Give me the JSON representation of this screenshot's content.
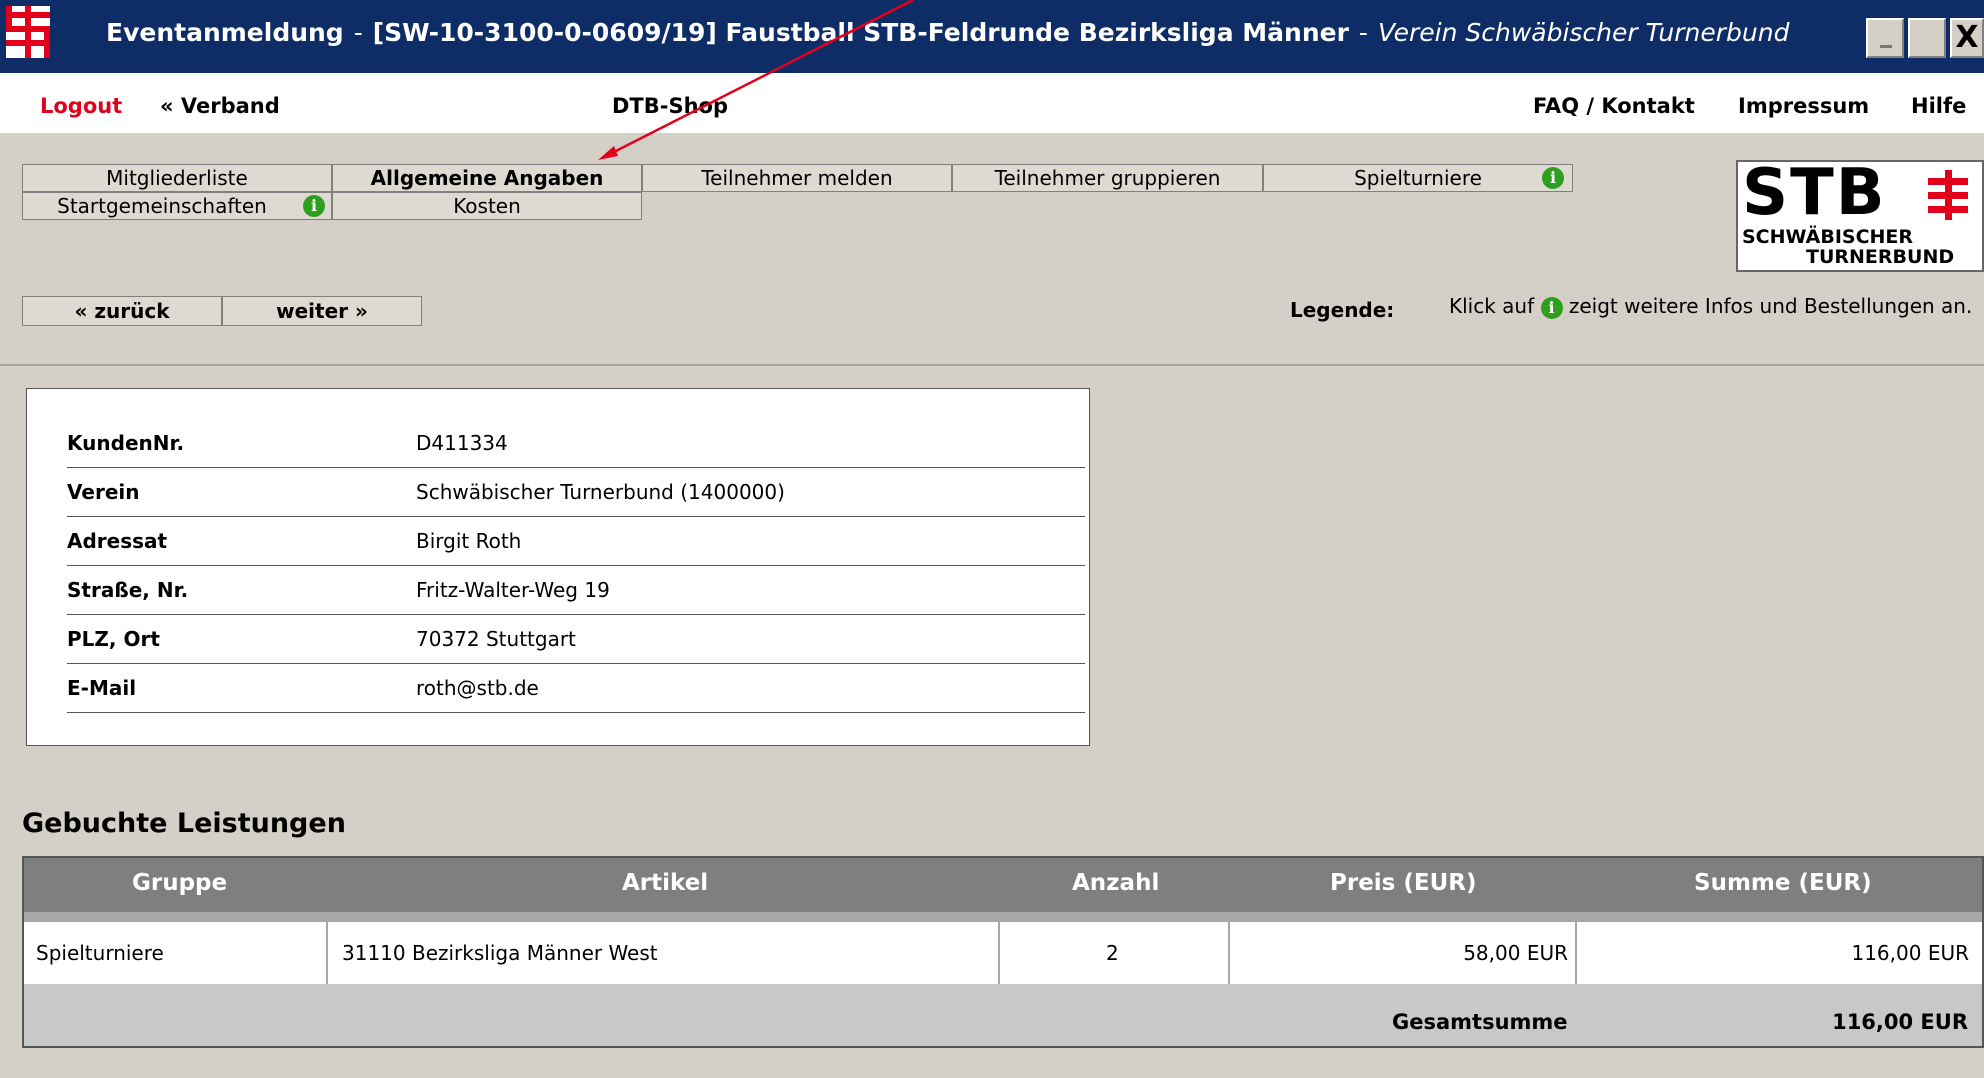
{
  "window": {
    "title_main": "Eventanmeldung",
    "title_sep": "-",
    "title_event": "[SW-10-3100-0-0609/19] Faustball STB-Feldrunde Bezirksliga Männer",
    "title_sep2": "-",
    "title_club": "Verein Schwäbischer Turnerbund",
    "close_label": "X"
  },
  "topnav": {
    "logout": "Logout",
    "verband": "« Verband",
    "shop": "DTB-Shop",
    "faq": "FAQ / Kontakt",
    "impressum": "Impressum",
    "hilfe": "Hilfe"
  },
  "tabs": {
    "mitgliederliste": "Mitgliederliste",
    "allgemeine": "Allgemeine Angaben",
    "teilnehmer_melden": "Teilnehmer melden",
    "teilnehmer_gruppieren": "Teilnehmer gruppieren",
    "spielturniere": "Spielturniere",
    "startgemeinschaften": "Startgemeinschaften",
    "kosten": "Kosten"
  },
  "logo": {
    "word": "STB",
    "line1": "SCHWÄBISCHER",
    "line2": "TURNERBUND"
  },
  "nav": {
    "back": "« zurück",
    "next": "weiter »"
  },
  "legend": {
    "label": "Legende:",
    "text_before": "Klick auf",
    "text_after": "zeigt weitere Infos und Bestellungen an.",
    "info_glyph": "i"
  },
  "customer": {
    "rows": [
      {
        "key": "KundenNr.",
        "value": "D411334"
      },
      {
        "key": "Verein",
        "value": "Schwäbischer Turnerbund (1400000)"
      },
      {
        "key": "Adressat",
        "value": "Birgit Roth"
      },
      {
        "key": "Straße, Nr.",
        "value": "Fritz-Walter-Weg 19"
      },
      {
        "key": "PLZ, Ort",
        "value": "70372 Stuttgart"
      },
      {
        "key": "E-Mail",
        "value": "roth@stb.de"
      }
    ]
  },
  "booked": {
    "title": "Gebuchte Leistungen",
    "headers": {
      "gruppe": "Gruppe",
      "artikel": "Artikel",
      "anzahl": "Anzahl",
      "preis": "Preis (EUR)",
      "summe": "Summe (EUR)"
    },
    "rows": [
      {
        "gruppe": "Spielturniere",
        "artikel": "31110 Bezirksliga Männer West",
        "anzahl": "2",
        "preis": "58,00 EUR",
        "summe": "116,00 EUR"
      }
    ],
    "total_label": "Gesamtsumme",
    "total_value": "116,00 EUR"
  },
  "colors": {
    "titlebar": "#0e2d66",
    "accent_red": "#e2001a",
    "info_green": "#2d9e1e",
    "background": "#d4d0c8"
  }
}
